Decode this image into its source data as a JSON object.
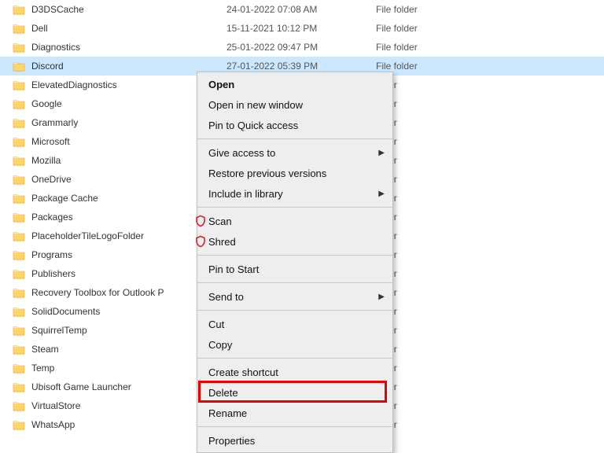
{
  "files": [
    {
      "name": "D3DSCache",
      "date": "24-01-2022 07:08 AM",
      "type": "File folder",
      "selected": false
    },
    {
      "name": "Dell",
      "date": "15-11-2021 10:12 PM",
      "type": "File folder",
      "selected": false
    },
    {
      "name": "Diagnostics",
      "date": "25-01-2022 09:47 PM",
      "type": "File folder",
      "selected": false
    },
    {
      "name": "Discord",
      "date": "27-01-2022 05:39 PM",
      "type": "File folder",
      "selected": true
    },
    {
      "name": "ElevatedDiagnostics",
      "date": "",
      "type": "older",
      "selected": false
    },
    {
      "name": "Google",
      "date": "",
      "type": "older",
      "selected": false
    },
    {
      "name": "Grammarly",
      "date": "",
      "type": "older",
      "selected": false
    },
    {
      "name": "Microsoft",
      "date": "",
      "type": "older",
      "selected": false
    },
    {
      "name": "Mozilla",
      "date": "",
      "type": "older",
      "selected": false
    },
    {
      "name": "OneDrive",
      "date": "",
      "type": "older",
      "selected": false
    },
    {
      "name": "Package Cache",
      "date": "",
      "type": "older",
      "selected": false
    },
    {
      "name": "Packages",
      "date": "",
      "type": "older",
      "selected": false
    },
    {
      "name": "PlaceholderTileLogoFolder",
      "date": "",
      "type": "older",
      "selected": false
    },
    {
      "name": "Programs",
      "date": "",
      "type": "older",
      "selected": false
    },
    {
      "name": "Publishers",
      "date": "",
      "type": "older",
      "selected": false
    },
    {
      "name": "Recovery Toolbox for Outlook P",
      "date": "",
      "type": "older",
      "selected": false
    },
    {
      "name": "SolidDocuments",
      "date": "",
      "type": "older",
      "selected": false
    },
    {
      "name": "SquirrelTemp",
      "date": "",
      "type": "older",
      "selected": false
    },
    {
      "name": "Steam",
      "date": "",
      "type": "older",
      "selected": false
    },
    {
      "name": "Temp",
      "date": "",
      "type": "older",
      "selected": false
    },
    {
      "name": "Ubisoft Game Launcher",
      "date": "",
      "type": "older",
      "selected": false
    },
    {
      "name": "VirtualStore",
      "date": "",
      "type": "older",
      "selected": false
    },
    {
      "name": "WhatsApp",
      "date": "",
      "type": "older",
      "selected": false
    }
  ],
  "menu": {
    "open": "Open",
    "open_new": "Open in new window",
    "pin_quick": "Pin to Quick access",
    "give_access": "Give access to",
    "restore_prev": "Restore previous versions",
    "include_lib": "Include in library",
    "scan": "Scan",
    "shred": "Shred",
    "pin_start": "Pin to Start",
    "send_to": "Send to",
    "cut": "Cut",
    "copy": "Copy",
    "create_shortcut": "Create shortcut",
    "delete": "Delete",
    "rename": "Rename",
    "properties": "Properties"
  },
  "colors": {
    "highlight": "#e60000",
    "selected_row": "#cce8ff",
    "menu_bg": "#eeeeee"
  }
}
